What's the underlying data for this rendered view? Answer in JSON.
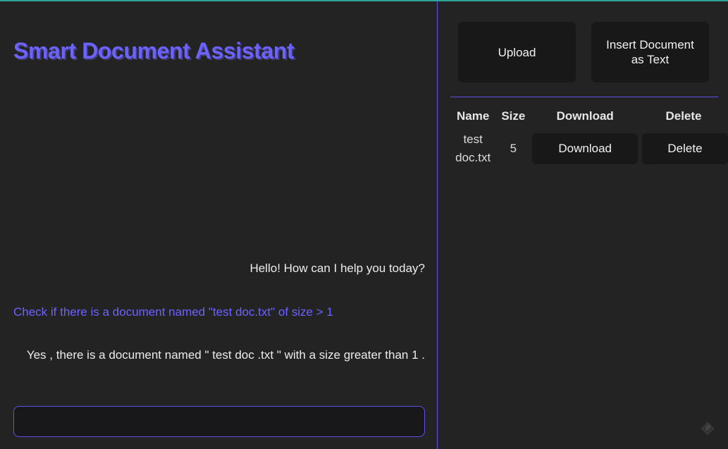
{
  "app": {
    "title": "Smart Document Assistant"
  },
  "chat": {
    "messages": [
      {
        "role": "assistant",
        "text": "Hello! How can I help you today?"
      },
      {
        "role": "user",
        "text": "Check if there is a document named \"test doc.txt\" of size > 1"
      },
      {
        "role": "assistant",
        "text": "Yes , there is a document named \" test doc .txt \" with a size greater than 1 ."
      }
    ],
    "input_value": ""
  },
  "actions": {
    "upload_label": "Upload",
    "insert_label": "Insert Document as Text"
  },
  "documents": {
    "headers": [
      "Name",
      "Size",
      "Download",
      "Delete"
    ],
    "rows": [
      {
        "name": "test doc.txt",
        "size": "5",
        "download_label": "Download",
        "delete_label": "Delete"
      }
    ]
  },
  "colors": {
    "accent": "#6c63ff",
    "border_accent": "#5b52e6",
    "top_strip": "#2fa39b",
    "background": "#232323",
    "button_bg": "#181818"
  },
  "icons": {
    "corner": "streamlit-logo-icon"
  }
}
